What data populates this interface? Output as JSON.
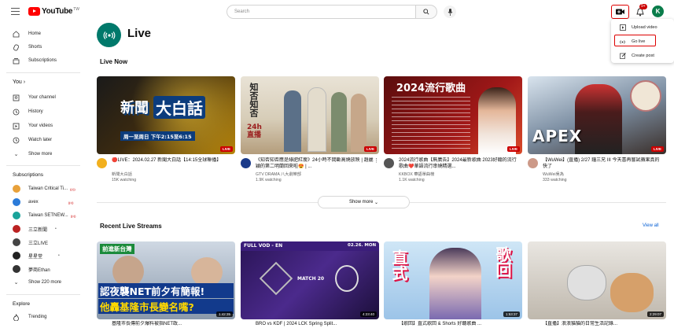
{
  "header": {
    "logo_word": "YouTube",
    "logo_region": "TW",
    "search_placeholder": "Search",
    "notif_count": "9+",
    "avatar_letter": "K"
  },
  "sidebar": {
    "main": [
      {
        "label": "Home",
        "icon": "home-icon"
      },
      {
        "label": "Shorts",
        "icon": "shorts-icon"
      },
      {
        "label": "Subscriptions",
        "icon": "subscriptions-icon"
      }
    ],
    "you_heading": "You",
    "you_items": [
      {
        "label": "Your channel",
        "icon": "channel-icon"
      },
      {
        "label": "History",
        "icon": "history-icon"
      },
      {
        "label": "Your videos",
        "icon": "videos-icon"
      },
      {
        "label": "Watch later",
        "icon": "clock-icon"
      },
      {
        "label": "Show more",
        "icon": "chevron-down-icon"
      }
    ],
    "subs_heading": "Subscriptions",
    "subs": [
      {
        "label": "Taiwan Critical Ti...",
        "color": "#e8a13a",
        "live": true
      },
      {
        "label": "avex",
        "color": "#2b7bd9",
        "live": true
      },
      {
        "label": "Taiwan SETNEW...",
        "color": "#1aa39a",
        "live": true
      },
      {
        "label": "三立新聞",
        "color": "#b22",
        "dot": true
      },
      {
        "label": "三立LIVE",
        "color": "#444"
      },
      {
        "label": "星星堂",
        "color": "#222",
        "dot": true
      },
      {
        "label": "夢商Ethan",
        "color": "#333"
      },
      {
        "label": "Show 220 more",
        "icon": "chevron-down-icon"
      }
    ],
    "explore_heading": "Explore",
    "explore": [
      {
        "label": "Trending",
        "icon": "trending-icon"
      }
    ]
  },
  "page": {
    "title": "Live",
    "live_now": "Live Now",
    "show_more": "Show more",
    "recent": "Recent Live Streams",
    "view_all": "View all"
  },
  "live_cards": [
    {
      "title": "🔴LIVE：2024.02.27 新聞大白話【14:15全球聯播】",
      "channel": "新聞大白話",
      "meta": "15K watching",
      "badge": "LIVE",
      "av": "#f2b01e"
    },
    {
      "title": "《知否知否應是綠肥紅瘦》24小時不間斷高燒放映 | 趙麗穎的第二明蘭回來啦😍 | ...",
      "channel": "GTV DRAMA 八大劇樂部",
      "meta": "1.9K watching",
      "badge": "LIVE",
      "av": "#1a3a8a"
    },
    {
      "title": "2024流行歌曲【無廣告】2024最新歌曲 2023好聽的流行歌曲❤️華語流行串燒精選...",
      "channel": "KKBOX 華語單曲榜",
      "meta": "1.1K watching",
      "badge": "LIVE",
      "av": "#555"
    },
    {
      "title": "【WuWei】(直播) 2/27 鐘三兄 III 今天喜再嘗試蘋果真的快了",
      "channel": "WuWei吳為",
      "meta": "333 watching",
      "badge": "LIVE",
      "av": "#c98"
    }
  ],
  "recent_cards": [
    {
      "dur": "1:42:35"
    },
    {
      "dur": "4:23:40"
    },
    {
      "dur": "1:53:37"
    },
    {
      "dur": "2:29:07"
    }
  ],
  "recent_titles": [
    "基隆市長傳前夕爆料被指NET政...",
    "BRO vs KDF | 2024 LCK Spring Split...",
    "【歌回】直式歌回 & Shorts 好聽歌曲 ...",
    "【直播】浪浪貓貓的日常生活記錄..."
  ],
  "create_menu": [
    {
      "label": "Upload video",
      "icon": "upload-icon"
    },
    {
      "label": "Go live",
      "icon": "go-live-icon"
    },
    {
      "label": "Create post",
      "icon": "edit-post-icon"
    }
  ],
  "thumb_text": {
    "t1_a": "新聞",
    "t1_b": "大白話",
    "t1_c": "周一至周日 下午2:15至6:15",
    "t2_a": "知否知否",
    "t2_b": "24h 直播",
    "t3_a": "2024流行歌曲",
    "t4_a": "APEX",
    "r1_a": "前進新台灣",
    "r1_b": "認夜襲NET前夕有簡報!",
    "r1_c": "他轟基隆市長變名嘴?",
    "r2_a": "FULL VOD - EN",
    "r2_b": "02.26. MON",
    "r2_c": "MATCH 20",
    "r3_a": "直式",
    "r3_b": "歌回"
  }
}
